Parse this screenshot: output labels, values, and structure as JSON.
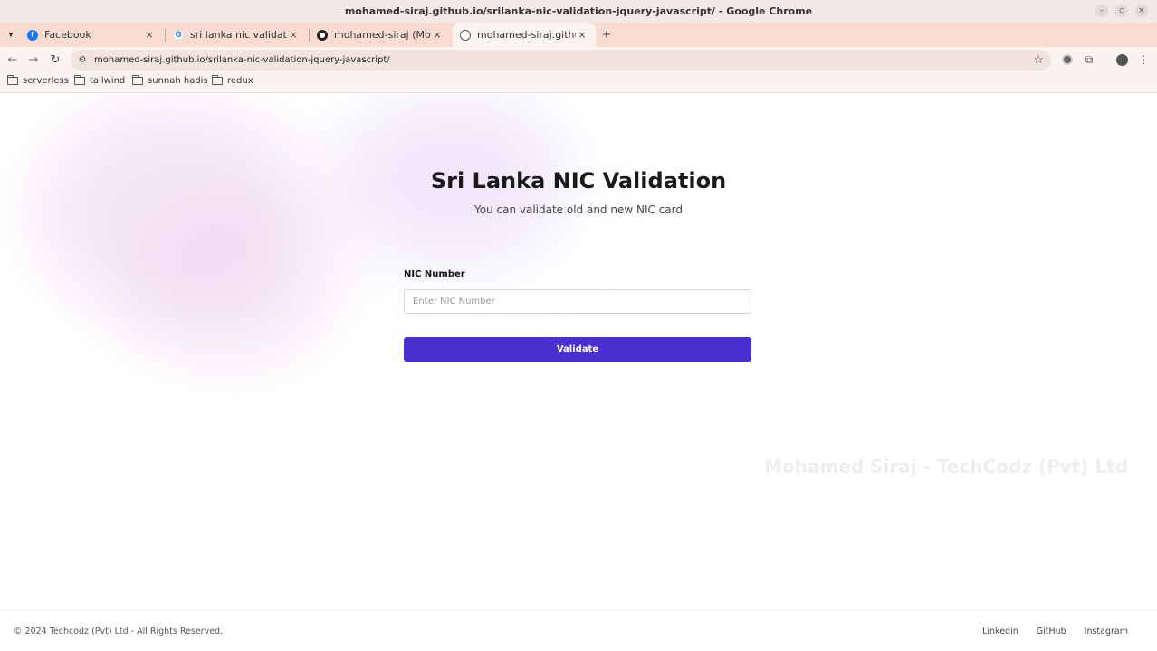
{
  "window": {
    "title": "mohamed-siraj.github.io/srilanka-nic-validation-jquery-javascript/ - Google Chrome"
  },
  "tabs": [
    {
      "label": "Facebook",
      "icon": "facebook-icon"
    },
    {
      "label": "sri lanka nic validation jq",
      "icon": "google-icon"
    },
    {
      "label": "mohamed-siraj (Moham",
      "icon": "github-icon"
    },
    {
      "label": "mohamed-siraj.github.io",
      "icon": "globe-icon"
    }
  ],
  "toolbar": {
    "url": "mohamed-siraj.github.io/srilanka-nic-validation-jquery-javascript/"
  },
  "bookmarks": [
    {
      "label": "serverless"
    },
    {
      "label": "tailwind"
    },
    {
      "label": "sunnah hadis"
    },
    {
      "label": "redux"
    }
  ],
  "main": {
    "title": "Sri Lanka NIC Validation",
    "subtitle": "You can validate old and new NIC card",
    "field_label": "NIC Number",
    "input_placeholder": "Enter NIC Number",
    "input_value": "",
    "button_label": "Validate",
    "watermark": "Mohamed Siraj - TechCodz (Pvt) Ltd"
  },
  "footer": {
    "copyright": "© 2024 Techcodz (Pvt) Ltd - All Rights Reserved.",
    "links": [
      "Linkedin",
      "GitHub",
      "Instagram"
    ]
  },
  "colors": {
    "accent": "#4c2fd1",
    "tabstrip": "#f8dcd2",
    "toolbar": "#fbf3f0"
  }
}
